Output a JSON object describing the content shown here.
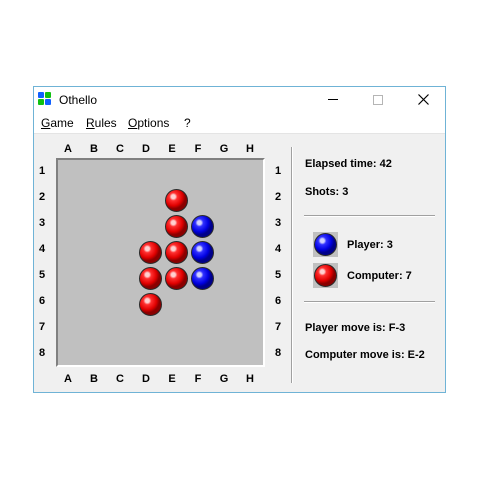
{
  "window": {
    "title": "Othello",
    "icon": "othello-app-icon",
    "controls": [
      "minimize-icon",
      "maximize-icon",
      "close-icon"
    ]
  },
  "menu": [
    {
      "label": "Game"
    },
    {
      "label": "Rules"
    },
    {
      "label": "Options"
    },
    {
      "label": "?"
    }
  ],
  "board": {
    "columns": [
      "A",
      "B",
      "C",
      "D",
      "E",
      "F",
      "G",
      "H"
    ],
    "rows": [
      "1",
      "2",
      "3",
      "4",
      "5",
      "6",
      "7",
      "8"
    ],
    "colors": {
      "player": "#0000e0",
      "computer": "#e00000",
      "board": "#c0c0c0"
    },
    "discs": [
      {
        "cell": "E-2",
        "owner": "computer"
      },
      {
        "cell": "E-3",
        "owner": "computer"
      },
      {
        "cell": "F-3",
        "owner": "player"
      },
      {
        "cell": "D-4",
        "owner": "computer"
      },
      {
        "cell": "E-4",
        "owner": "computer"
      },
      {
        "cell": "F-4",
        "owner": "player"
      },
      {
        "cell": "D-5",
        "owner": "computer"
      },
      {
        "cell": "E-5",
        "owner": "computer"
      },
      {
        "cell": "F-5",
        "owner": "player"
      },
      {
        "cell": "D-6",
        "owner": "computer"
      }
    ]
  },
  "status": {
    "elapsed": "Elapsed time: 42",
    "shots": "Shots: 3",
    "player": "Player: 3",
    "computer": "Computer: 7",
    "player_move": "Player move is: F-3",
    "computer_move": "Computer move is: E-2"
  }
}
